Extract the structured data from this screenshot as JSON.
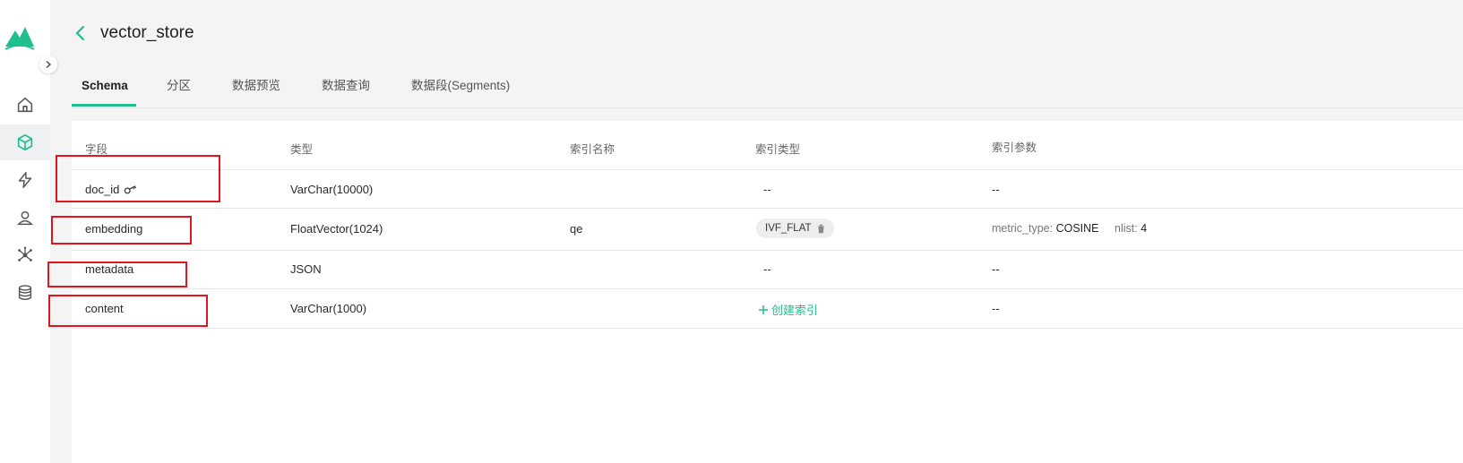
{
  "collection": {
    "title": "vector_store"
  },
  "tabs": [
    {
      "label": "Schema"
    },
    {
      "label": "分区"
    },
    {
      "label": "数据预览"
    },
    {
      "label": "数据查询"
    },
    {
      "label": "数据段(Segments)"
    }
  ],
  "table": {
    "headers": {
      "field": "字段",
      "type": "类型",
      "index_name": "索引名称",
      "index_type": "索引类型",
      "index_params": "索引参数"
    },
    "rows": [
      {
        "field": "doc_id",
        "type": "VarChar(10000)",
        "index_name": "",
        "index_type": "--",
        "index_params": "--"
      },
      {
        "field": "embedding",
        "type": "FloatVector(1024)",
        "index_name": "qe",
        "index_type": "IVF_FLAT",
        "params": {
          "metric_key": "metric_type:",
          "metric_val": "COSINE",
          "nlist_key": "nlist:",
          "nlist_val": "4"
        }
      },
      {
        "field": "metadata",
        "type": "JSON",
        "index_name": "",
        "index_type": "--",
        "index_params": "--"
      },
      {
        "field": "content",
        "type": "VarChar(1000)",
        "index_name": "",
        "index_type": "创建索引",
        "index_params": "--"
      }
    ]
  },
  "icons": {
    "logo": "milvus-logo",
    "back": "chevron-left-icon",
    "collapse": "chevron-right-icon",
    "nav": [
      "home-icon",
      "cube-icon",
      "lightning-icon",
      "user-icon",
      "cluster-icon",
      "database-icon"
    ],
    "primary_key": "key-icon",
    "trash": "trash-icon",
    "add": "plus-icon"
  },
  "colors": {
    "accent": "#1fbf8f",
    "highlight": "#e0161c",
    "background": "#f4f4f5"
  }
}
